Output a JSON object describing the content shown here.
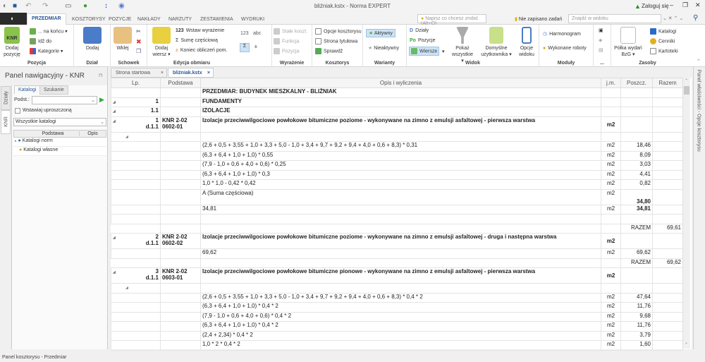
{
  "window": {
    "title": "bliźniak.kstx - Norma EXPERT",
    "login": "Zaloguj się"
  },
  "ribbon_tabs": [
    "PRZEDMIAR",
    "KOSZTORYSY",
    "POZYCJE",
    "NAKŁADY",
    "NARZUTY",
    "ZESTAWIENIA",
    "WYDRUKI"
  ],
  "toolbar": {
    "tell_me": "Napisz co chcesz zrobić (Alt+Q)",
    "tasks": "Nie zapisano zadań",
    "find": "Znajdź w widoku"
  },
  "groups": {
    "pozycja": {
      "label": "Pozycja",
      "add": "Dodaj pozycję",
      "na_koncu": "... na końcu",
      "idz_do": "Idź do",
      "kategorie": "Kategorie"
    },
    "dzial": {
      "label": "Dział",
      "add": "Dodaj"
    },
    "schowek": {
      "label": "Schowek",
      "paste": "Wklej"
    },
    "edycja": {
      "label": "Edycja obmiaru",
      "add_row": "Dodaj wiersz",
      "wstaw": "Wstaw wyrażenie",
      "sume": "Sumę częściową",
      "koniec": "Koniec obliczeń pom."
    },
    "wyrazenie": {
      "label": "Wyrażenie",
      "stale": "Stałe koszt.",
      "funkcja": "Funkcja",
      "pozycja": "Pozycja",
      "n123": "123",
      "abc": "abc"
    },
    "kosztorys": {
      "label": "Kosztorys",
      "opcje": "Opcje kosztorysu",
      "strona": "Strona tytułowa",
      "sprawdz": "Sprawdź"
    },
    "warianty": {
      "label": "Warianty",
      "aktywny": "Aktywny",
      "nieaktywny": "Nieaktywny"
    },
    "widok": {
      "label": "Widok",
      "dzialy": "Działy",
      "pozycje": "Pozycje",
      "wiersze": "Wiersze",
      "pokaz": "Pokaż wszystkie",
      "domyslne": "Domyślne użytkownika",
      "opcje": "Opcje widoku"
    },
    "moduly": {
      "label": "Moduły",
      "harmonogram": "Harmonogram",
      "wykonane": "Wykonane roboty"
    },
    "more": {
      "label": "..."
    },
    "zasoby": {
      "label": "Zasoby",
      "polka": "Półka wydań BzG",
      "katalogi": "Katalogi",
      "cenniki": "Cenniki",
      "kartoteki": "Kartoteki"
    }
  },
  "nav": {
    "title": "Panel nawigacyjny - KNR",
    "vtabs": [
      "Działy",
      "KNR"
    ],
    "tabs": [
      "Katalogi",
      "Szukanie"
    ],
    "podst_label": "Podst.:",
    "podst_value": "",
    "checkbox": "Wstawiaj uproszczoną",
    "select": "Wszystkie katalogi",
    "cols": [
      "Podstawa",
      "Opis"
    ],
    "items": [
      "Katalogi norm",
      "Katalogi własne"
    ]
  },
  "doc_tabs": [
    "Strona startowa",
    "bliźniak.kstx"
  ],
  "columns": [
    "Lp.",
    "Podstawa",
    "Opis i wyliczenia",
    "j.m.",
    "Poszcz.",
    "Razem"
  ],
  "rows": [
    {
      "k": "hdr",
      "opis": "PRZEDMIAR: BUDYNEK  MIESZKALNY - BLIŹNIAK"
    },
    {
      "k": "hdr",
      "lp": "1",
      "opis": "FUNDAMENTY"
    },
    {
      "k": "hdr",
      "lp": "1.1",
      "opis": "IZOLACJE"
    },
    {
      "k": "pos",
      "lp": "1",
      "lp2": "d.1.1",
      "pod": "KNR 2-02",
      "pod2": "0602-01",
      "opis": "Izolacje przeciwwilgociowe powłokowe bitumiczne poziome - wykonywane na zimno z emulsji asfaltowej - pierwsza warstwa",
      "jm": "m2"
    },
    {
      "k": "blank"
    },
    {
      "k": "m",
      "opis": "(2,6 + 0,5 + 3,55 + 1,0 + 3,3 + 5,0 - 1,0 + 3,4 + 9,7 + 9,2 + 9,4 + 4,0 + 0,6 + 8,3) * 0,31",
      "jm": "m2",
      "p": "18,46"
    },
    {
      "k": "m",
      "opis": "(6,3 + 6,4 + 1,0 + 1,0) * 0,55",
      "jm": "m2",
      "p": "8,09"
    },
    {
      "k": "m",
      "opis": "(7,9 - 1,0 + 0,6 + 4,0 + 0,6) * 0,25",
      "jm": "m2",
      "p": "3,03"
    },
    {
      "k": "m",
      "opis": "(6,3 + 6,4 + 1,0 + 1,0) * 0,3",
      "jm": "m2",
      "p": "4,41"
    },
    {
      "k": "m",
      "opis": "1,0 * 1,0 - 0,42 * 0,42",
      "jm": "m2",
      "p": "0,82"
    },
    {
      "k": "sum",
      "opis": "A (Suma częściowa)",
      "jm": "m2",
      "p": "34,80"
    },
    {
      "k": "tot",
      "opis": "34,81",
      "jm": "m2",
      "p": "34,81"
    },
    {
      "k": "blank"
    },
    {
      "k": "raz",
      "p": "RAZEM",
      "r": "69,61"
    },
    {
      "k": "pos",
      "lp": "2",
      "lp2": "d.1.1",
      "pod": "KNR 2-02",
      "pod2": "0602-02",
      "opis": "Izolacje przeciwwilgociowe powłokowe bitumiczne poziome - wykonywane na zimno z emulsji asfaltowej - druga i następna warstwa",
      "jm": "m2"
    },
    {
      "k": "m",
      "opis": "69,62",
      "jm": "m2",
      "p": "69,62"
    },
    {
      "k": "raz",
      "p": "RAZEM",
      "r": "69,62"
    },
    {
      "k": "pos",
      "lp": "3",
      "lp2": "d.1.1",
      "pod": "KNR 2-02",
      "pod2": "0603-01",
      "opis": "Izolacje przeciwwilgociowe powłokowe bitumiczne pionowe - wykonywane na zimno z emulsji asfaltowej - pierwsza warstwa",
      "jm": "m2"
    },
    {
      "k": "blank"
    },
    {
      "k": "m",
      "opis": "(2,6 + 0,5 + 3,55 + 1,0 + 3,3 + 5,0 - 1,0 + 3,4 + 9,7 + 9,2 + 9,4 + 4,0 + 0,6 + 8,3) * 0,4 * 2",
      "jm": "m2",
      "p": "47,64"
    },
    {
      "k": "m",
      "opis": "(6,3 + 6,4 + 1,0 + 1,0) * 0,4 * 2",
      "jm": "m2",
      "p": "11,76"
    },
    {
      "k": "m",
      "opis": "(7,9 - 1,0 + 0,6 + 4,0 + 0,6) * 0,4 * 2",
      "jm": "m2",
      "p": "9,68"
    },
    {
      "k": "m",
      "opis": "(6,3 + 6,4 + 1,0 + 1,0) * 0,4 * 2",
      "jm": "m2",
      "p": "11,76"
    },
    {
      "k": "m",
      "opis": "(2,4 + 2,34) * 0,4 * 2",
      "jm": "m2",
      "p": "3,79"
    },
    {
      "k": "m",
      "opis": "1,0 * 2 * 0,4 * 2",
      "jm": "m2",
      "p": "1,60"
    }
  ],
  "right_panel": "Panel właściwości - Opcje kosztorysu",
  "status": "Panel kosztorysu - Przedmiar"
}
